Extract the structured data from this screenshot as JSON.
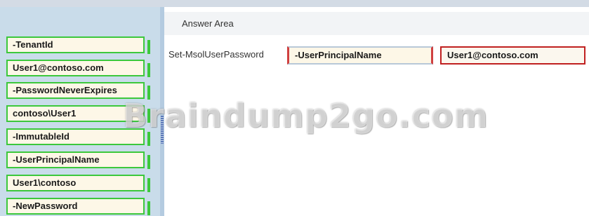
{
  "answer_area": {
    "title": "Answer Area",
    "command": "Set-MsolUserPassword",
    "slots": [
      "-UserPrincipalName",
      "User1@contoso.com"
    ]
  },
  "options": [
    "-TenantId",
    "User1@contoso.com",
    "-PasswordNeverExpires",
    "contoso\\User1",
    "-ImmutableId",
    "-UserPrincipalName",
    "User1\\contoso",
    "-NewPassword"
  ],
  "watermark": "Braindump2go.com"
}
